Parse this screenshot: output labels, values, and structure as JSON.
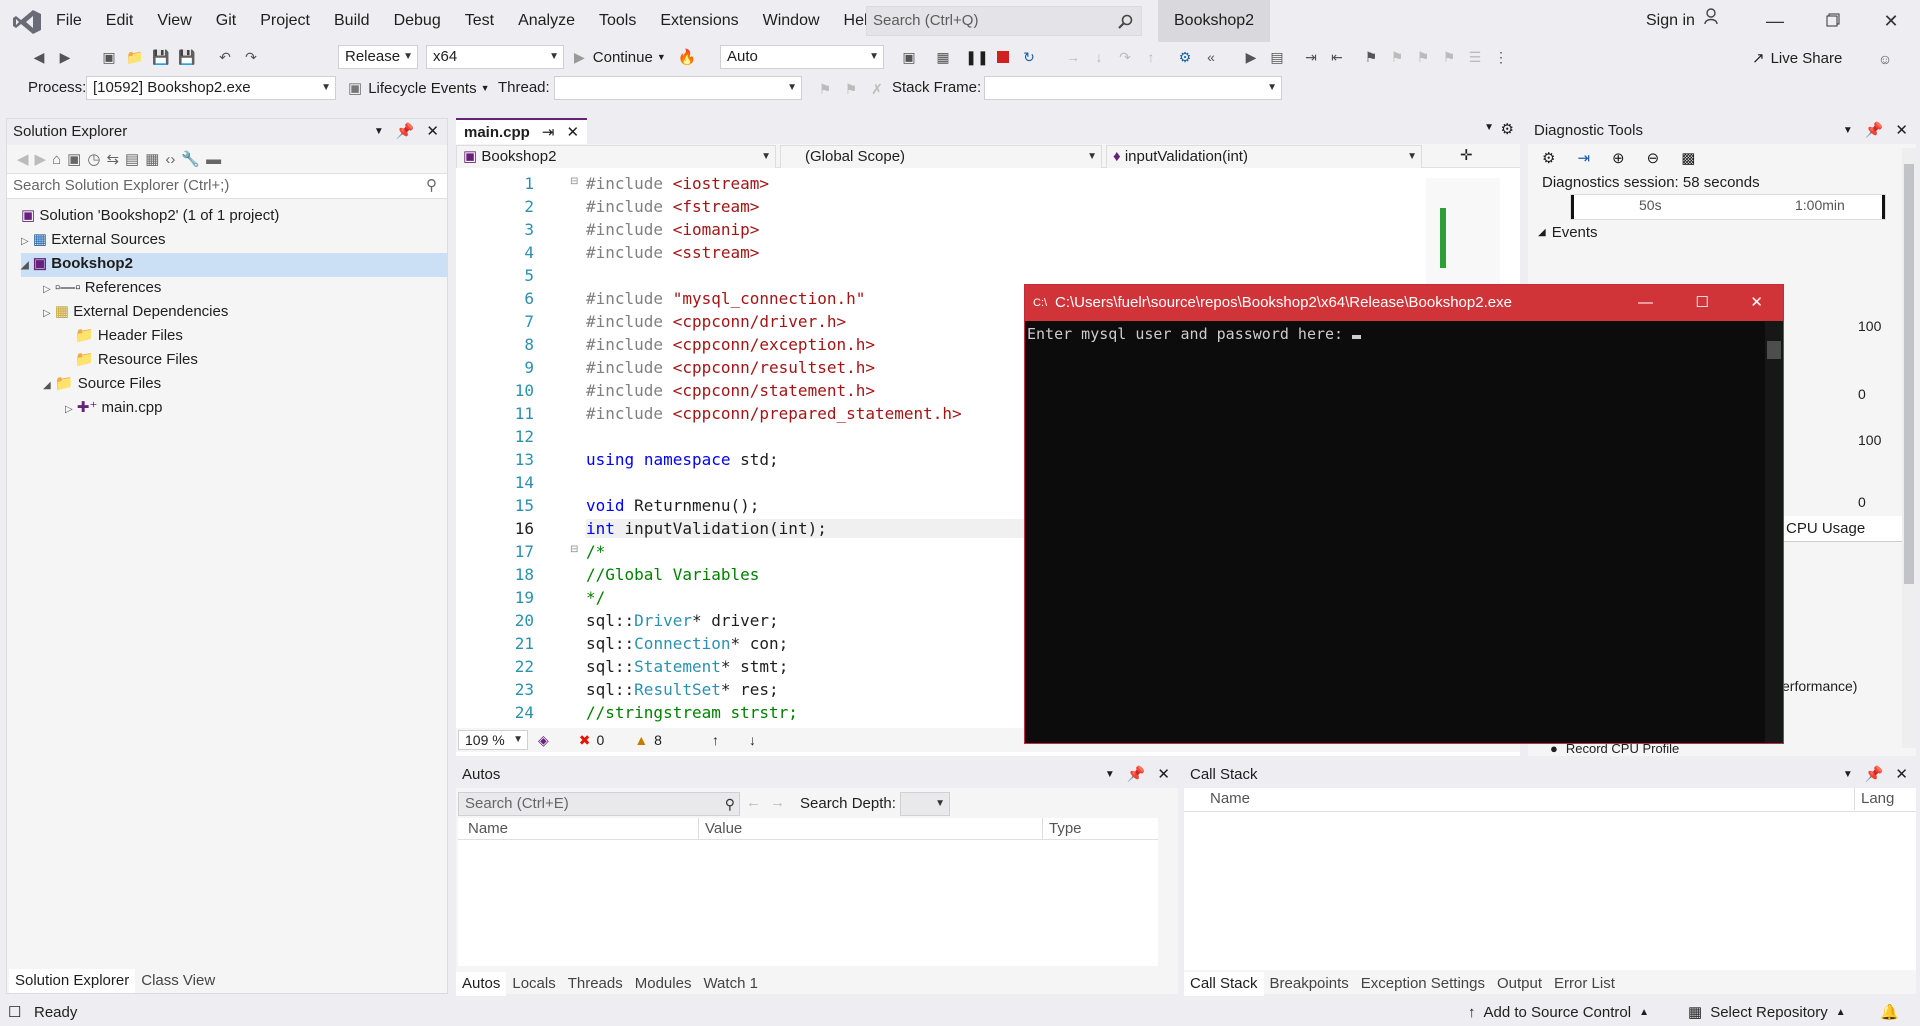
{
  "menubar": {
    "items": [
      "File",
      "Edit",
      "View",
      "Git",
      "Project",
      "Build",
      "Debug",
      "Test",
      "Analyze",
      "Tools",
      "Extensions",
      "Window",
      "Help"
    ],
    "search_placeholder": "Search (Ctrl+Q)",
    "solution_name": "Bookshop2",
    "sign_in": "Sign in"
  },
  "toolbar": {
    "config": "Release",
    "platform": "x64",
    "continue_label": "Continue",
    "auto_label": "Auto",
    "live_share": "Live Share",
    "process_label": "Process:",
    "process_value": "[10592] Bookshop2.exe",
    "lifecycle_label": "Lifecycle Events",
    "thread_label": "Thread:",
    "stack_frame_label": "Stack Frame:"
  },
  "solution_explorer": {
    "title": "Solution Explorer",
    "search_placeholder": "Search Solution Explorer (Ctrl+;)",
    "items": [
      "Solution 'Bookshop2' (1 of 1 project)",
      "External Sources",
      "Bookshop2",
      "References",
      "External Dependencies",
      "Header Files",
      "Resource Files",
      "Source Files",
      "main.cpp"
    ],
    "tabs": [
      "Solution Explorer",
      "Class View"
    ]
  },
  "editor": {
    "tab": "main.cpp",
    "nav_project": "Bookshop2",
    "nav_scope": "(Global Scope)",
    "nav_member": "inputValidation(int)",
    "zoom": "109 %",
    "errors": "0",
    "warnings": "8",
    "lines": [
      {
        "n": "1"
      },
      {
        "n": "2"
      },
      {
        "n": "3"
      },
      {
        "n": "4"
      },
      {
        "n": "5"
      },
      {
        "n": "6"
      },
      {
        "n": "7"
      },
      {
        "n": "8"
      },
      {
        "n": "9"
      },
      {
        "n": "10"
      },
      {
        "n": "11"
      },
      {
        "n": "12"
      },
      {
        "n": "13"
      },
      {
        "n": "14"
      },
      {
        "n": "15"
      },
      {
        "n": "16"
      },
      {
        "n": "17"
      },
      {
        "n": "18"
      },
      {
        "n": "19"
      },
      {
        "n": "20"
      },
      {
        "n": "21"
      },
      {
        "n": "22"
      },
      {
        "n": "23"
      },
      {
        "n": "24"
      }
    ],
    "code": {
      "l1a": "#include",
      "l1b": "<iostream>",
      "l2a": "#include",
      "l2b": "<fstream>",
      "l3a": "#include",
      "l3b": "<iomanip>",
      "l4a": "#include",
      "l4b": "<sstream>",
      "l6a": "#include",
      "l6b": "\"mysql_connection.h\"",
      "l7a": "#include",
      "l7b": "<cppconn/driver.h>",
      "l8a": "#include",
      "l8b": "<cppconn/exception.h>",
      "l9a": "#include",
      "l9b": "<cppconn/resultset.h>",
      "l10a": "#include",
      "l10b": "<cppconn/statement.h>",
      "l11a": "#include",
      "l11b": "<cppconn/prepared_statement.h>",
      "l13a": "using",
      "l13b": "namespace",
      "l13c": "std;",
      "l15a": "void",
      "l15b": "Returnmenu();",
      "l16a": "int",
      "l16b": "inputValidation(int);",
      "l17": "/*",
      "l18": "//Global Variables",
      "l19": "*/",
      "l20a": "sql",
      "l20b": "::",
      "l20c": "Driver",
      "l20d": "*",
      "l20e": "driver;",
      "l21a": "sql",
      "l21b": "::",
      "l21c": "Connection",
      "l21d": "*",
      "l21e": "con;",
      "l22a": "sql",
      "l22b": "::",
      "l22c": "Statement",
      "l22d": "*",
      "l22e": "stmt;",
      "l23a": "sql",
      "l23b": "::",
      "l23c": "ResultSet",
      "l23d": "*",
      "l23e": "res;",
      "l24": "//stringstream strstr;"
    }
  },
  "console": {
    "title": "C:\\Users\\fuelr\\source\\repos\\Bookshop2\\x64\\Release\\Bookshop2.exe",
    "text": "Enter mysql user and password here: "
  },
  "diagnostics": {
    "title": "Diagnostic Tools",
    "session": "Diagnostics session: 58 seconds",
    "t1": "50s",
    "t2": "1:00min",
    "events": "Events",
    "y100a": "100",
    "y0a": "0",
    "y100b": "100",
    "y0b": "0",
    "cpu_usage": "CPU Usage",
    "performance": "erformance)",
    "record": "Record CPU Profile"
  },
  "autos": {
    "title": "Autos",
    "search_placeholder": "Search (Ctrl+E)",
    "search_depth": "Search Depth:",
    "columns": [
      "Name",
      "Value",
      "Type"
    ],
    "tabs": [
      "Autos",
      "Locals",
      "Threads",
      "Modules",
      "Watch 1"
    ]
  },
  "callstack": {
    "title": "Call Stack",
    "columns": [
      "Name",
      "Lang"
    ],
    "tabs": [
      "Call Stack",
      "Breakpoints",
      "Exception Settings",
      "Output",
      "Error List"
    ]
  },
  "status": {
    "ready": "Ready",
    "add_source": "Add to Source Control",
    "select_repo": "Select Repository"
  },
  "colors": {
    "accent": "#68217a",
    "console_title": "#d13438",
    "keyword": "#0000ff",
    "string": "#a31515",
    "comment": "#008000",
    "type": "#2b91af"
  }
}
